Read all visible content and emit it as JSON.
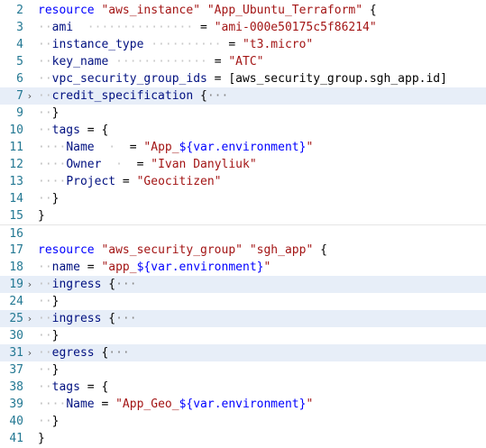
{
  "editor": {
    "language": "terraform",
    "lines": [
      {
        "n": "2",
        "fold": "",
        "folded": false,
        "sep": false,
        "tokens": [
          [
            "k",
            "resource"
          ],
          [
            "p",
            " "
          ],
          [
            "s",
            "\"aws_instance\""
          ],
          [
            "p",
            " "
          ],
          [
            "s",
            "\"App_Ubuntu_Terraform\""
          ],
          [
            "p",
            " {"
          ]
        ]
      },
      {
        "n": "3",
        "fold": "",
        "folded": false,
        "sep": false,
        "tokens": [
          [
            "g",
            "··"
          ],
          [
            "i",
            "ami"
          ],
          [
            "dots",
            "  ··············· "
          ],
          [
            "p",
            "= "
          ],
          [
            "s",
            "\"ami-000e50175c5f86214\""
          ]
        ]
      },
      {
        "n": "4",
        "fold": "",
        "folded": false,
        "sep": false,
        "tokens": [
          [
            "g",
            "··"
          ],
          [
            "i",
            "instance_type"
          ],
          [
            "dots",
            " ·········· "
          ],
          [
            "p",
            "= "
          ],
          [
            "s",
            "\"t3.micro\""
          ]
        ]
      },
      {
        "n": "5",
        "fold": "",
        "folded": false,
        "sep": false,
        "tokens": [
          [
            "g",
            "··"
          ],
          [
            "i",
            "key_name"
          ],
          [
            "dots",
            " ············· "
          ],
          [
            "p",
            "= "
          ],
          [
            "s",
            "\"ATC\""
          ]
        ]
      },
      {
        "n": "6",
        "fold": "",
        "folded": false,
        "sep": false,
        "tokens": [
          [
            "g",
            "··"
          ],
          [
            "i",
            "vpc_security_group_ids"
          ],
          [
            "p",
            " = [aws_security_group.sgh_app.id]"
          ]
        ]
      },
      {
        "n": "7",
        "fold": "›",
        "folded": true,
        "sep": false,
        "tokens": [
          [
            "g",
            "··"
          ],
          [
            "i",
            "credit_specification"
          ],
          [
            "p",
            " {"
          ],
          [
            "ell",
            "···"
          ]
        ]
      },
      {
        "n": "9",
        "fold": "",
        "folded": false,
        "sep": false,
        "tokens": [
          [
            "g",
            "··"
          ],
          [
            "p",
            "}"
          ]
        ]
      },
      {
        "n": "10",
        "fold": "",
        "folded": false,
        "sep": false,
        "tokens": [
          [
            "g",
            "··"
          ],
          [
            "i",
            "tags"
          ],
          [
            "p",
            " = {"
          ]
        ]
      },
      {
        "n": "11",
        "fold": "",
        "folded": false,
        "sep": false,
        "tokens": [
          [
            "g",
            "····"
          ],
          [
            "i",
            "Name"
          ],
          [
            "dots",
            "  ·  "
          ],
          [
            "p",
            "= "
          ],
          [
            "s",
            "\"App_"
          ],
          [
            "ph",
            "${var.environment}"
          ],
          [
            "s",
            "\""
          ]
        ]
      },
      {
        "n": "12",
        "fold": "",
        "folded": false,
        "sep": false,
        "tokens": [
          [
            "g",
            "····"
          ],
          [
            "i",
            "Owner"
          ],
          [
            "dots",
            "  ·  "
          ],
          [
            "p",
            "= "
          ],
          [
            "s",
            "\"Ivan Danyliuk\""
          ]
        ]
      },
      {
        "n": "13",
        "fold": "",
        "folded": false,
        "sep": false,
        "tokens": [
          [
            "g",
            "····"
          ],
          [
            "i",
            "Project"
          ],
          [
            "p",
            " = "
          ],
          [
            "s",
            "\"Geocitizen\""
          ]
        ]
      },
      {
        "n": "14",
        "fold": "",
        "folded": false,
        "sep": false,
        "tokens": [
          [
            "g",
            "··"
          ],
          [
            "p",
            "}"
          ]
        ]
      },
      {
        "n": "15",
        "fold": "",
        "folded": false,
        "sep": false,
        "tokens": [
          [
            "p",
            "}"
          ]
        ]
      },
      {
        "n": "16",
        "fold": "",
        "folded": false,
        "sep": true,
        "tokens": []
      },
      {
        "n": "17",
        "fold": "",
        "folded": false,
        "sep": false,
        "tokens": [
          [
            "k",
            "resource"
          ],
          [
            "p",
            " "
          ],
          [
            "s",
            "\"aws_security_group\""
          ],
          [
            "p",
            " "
          ],
          [
            "s",
            "\"sgh_app\""
          ],
          [
            "p",
            " {"
          ]
        ]
      },
      {
        "n": "18",
        "fold": "",
        "folded": false,
        "sep": false,
        "tokens": [
          [
            "g",
            "··"
          ],
          [
            "i",
            "name"
          ],
          [
            "p",
            " = "
          ],
          [
            "s",
            "\"app_"
          ],
          [
            "ph",
            "${var.environment}"
          ],
          [
            "s",
            "\""
          ]
        ]
      },
      {
        "n": "19",
        "fold": "›",
        "folded": true,
        "sep": false,
        "tokens": [
          [
            "g",
            "··"
          ],
          [
            "i",
            "ingress"
          ],
          [
            "p",
            " {"
          ],
          [
            "ell",
            "···"
          ]
        ]
      },
      {
        "n": "24",
        "fold": "",
        "folded": false,
        "sep": false,
        "tokens": [
          [
            "g",
            "··"
          ],
          [
            "p",
            "}"
          ]
        ]
      },
      {
        "n": "25",
        "fold": "›",
        "folded": true,
        "sep": false,
        "tokens": [
          [
            "g",
            "··"
          ],
          [
            "i",
            "ingress"
          ],
          [
            "p",
            " {"
          ],
          [
            "ell",
            "···"
          ]
        ]
      },
      {
        "n": "30",
        "fold": "",
        "folded": false,
        "sep": false,
        "tokens": [
          [
            "g",
            "··"
          ],
          [
            "p",
            "}"
          ]
        ]
      },
      {
        "n": "31",
        "fold": "›",
        "folded": true,
        "sep": false,
        "tokens": [
          [
            "g",
            "··"
          ],
          [
            "i",
            "egress"
          ],
          [
            "p",
            " {"
          ],
          [
            "ell",
            "···"
          ]
        ]
      },
      {
        "n": "37",
        "fold": "",
        "folded": false,
        "sep": false,
        "tokens": [
          [
            "g",
            "··"
          ],
          [
            "p",
            "}"
          ]
        ]
      },
      {
        "n": "38",
        "fold": "",
        "folded": false,
        "sep": false,
        "tokens": [
          [
            "g",
            "··"
          ],
          [
            "i",
            "tags"
          ],
          [
            "p",
            " = {"
          ]
        ]
      },
      {
        "n": "39",
        "fold": "",
        "folded": false,
        "sep": false,
        "tokens": [
          [
            "g",
            "····"
          ],
          [
            "i",
            "Name"
          ],
          [
            "p",
            " = "
          ],
          [
            "s",
            "\"App_Geo_"
          ],
          [
            "ph",
            "${var.environment}"
          ],
          [
            "s",
            "\""
          ]
        ]
      },
      {
        "n": "40",
        "fold": "",
        "folded": false,
        "sep": false,
        "tokens": [
          [
            "g",
            "··"
          ],
          [
            "p",
            "}"
          ]
        ]
      },
      {
        "n": "41",
        "fold": "",
        "folded": false,
        "sep": false,
        "tokens": [
          [
            "p",
            "}"
          ]
        ]
      }
    ],
    "colors": {
      "keyword": "#0000ff",
      "string": "#a31515",
      "identifier": "#001080",
      "line_number": "#237893",
      "folded_highlight": "#e7eef8"
    }
  }
}
